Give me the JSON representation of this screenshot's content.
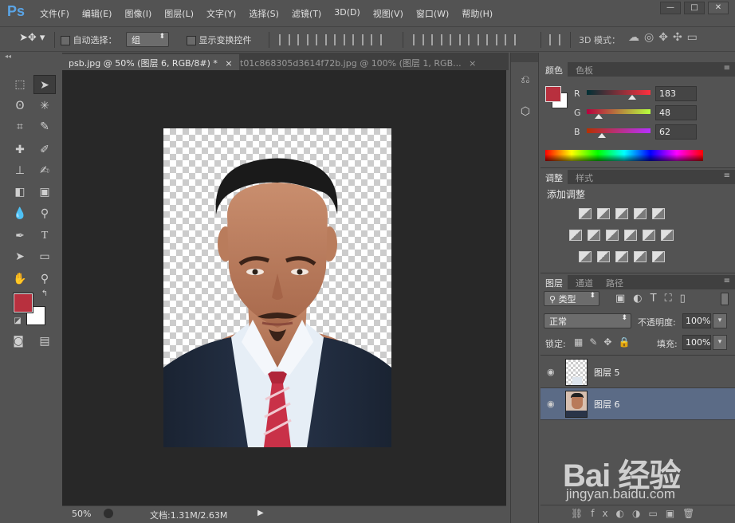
{
  "app": {
    "logo": "Ps",
    "menu": [
      "文件(F)",
      "编辑(E)",
      "图像(I)",
      "图层(L)",
      "文字(Y)",
      "选择(S)",
      "滤镜(T)",
      "3D(D)",
      "视图(V)",
      "窗口(W)",
      "帮助(H)"
    ],
    "window_buttons": [
      "—",
      "□",
      "✕"
    ]
  },
  "options": {
    "auto_select_label": "自动选择：",
    "auto_select_value": "组",
    "show_transform_label": "显示变换控件",
    "mode_3d_label": "3D 模式："
  },
  "tabs": [
    {
      "label": "psb.jpg @ 50% (图层 6, RGB/8#) *",
      "close": "×"
    },
    {
      "label": "t01c868305d3614f72b.jpg @ 100% (图层 1, RGB...",
      "close": "×"
    }
  ],
  "status": {
    "zoom": "50%",
    "doc_info": "文档:1.31M/2.63M"
  },
  "color_panel": {
    "tabs": [
      "颜色",
      "色板"
    ],
    "foreground": "#b8303e",
    "background": "#ffffff",
    "channels": [
      {
        "label": "R",
        "value": "183"
      },
      {
        "label": "G",
        "value": "48"
      },
      {
        "label": "B",
        "value": "62"
      }
    ]
  },
  "adjust_panel": {
    "tabs": [
      "调整",
      "样式"
    ],
    "title": "添加调整"
  },
  "layers_panel": {
    "tabs": [
      "图层",
      "通道",
      "路径"
    ],
    "filter_kind": "类型",
    "blend_mode": "正常",
    "opacity_label": "不透明度:",
    "opacity_value": "100%",
    "lock_label": "锁定:",
    "fill_label": "填充:",
    "fill_value": "100%",
    "layers": [
      {
        "name": "图层 5",
        "selected": false
      },
      {
        "name": "图层 6",
        "selected": true
      }
    ]
  },
  "watermark": {
    "main": "Bai 经验",
    "sub": "jingyan.baidu.com"
  }
}
